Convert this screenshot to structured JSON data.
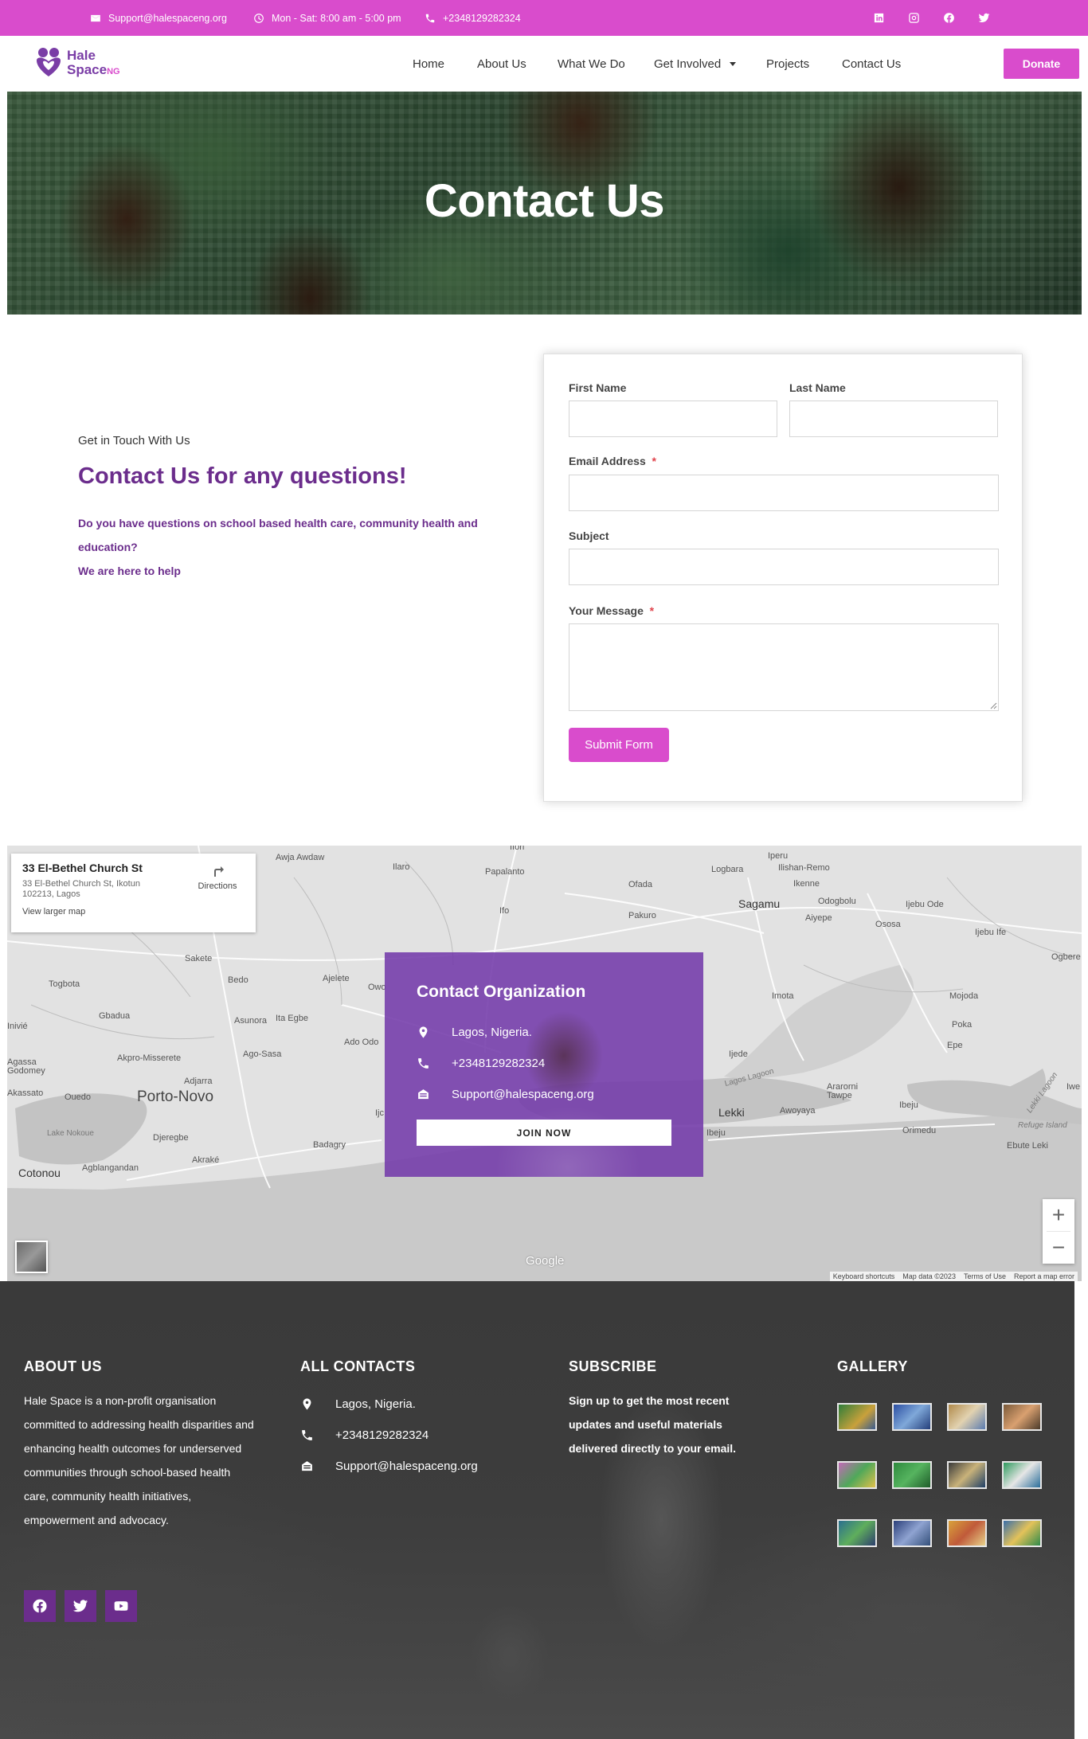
{
  "topbar": {
    "email": "Support@halespaceng.org",
    "hours": "Mon - Sat: 8:00 am - 5:00 pm",
    "phone": "+2348129282324",
    "socials": [
      "linkedin-icon",
      "instagram-icon",
      "facebook-icon",
      "twitter-icon"
    ]
  },
  "nav": {
    "logo_text_1": "Hale",
    "logo_text_2": "Space",
    "logo_text_3": "NG",
    "items": [
      "Home",
      "About Us",
      "What We Do",
      "Get Involved",
      "Projects",
      "Contact Us"
    ],
    "donate": "Donate"
  },
  "hero": {
    "title": "Contact Us"
  },
  "intro": {
    "eyebrow": "Get in Touch With Us",
    "title": "Contact Us for any questions!",
    "text1": "Do you have questions on school based health care, community health and education?",
    "text2": "We are here to help"
  },
  "form": {
    "first_name": "First Name",
    "last_name": "Last Name",
    "email": "Email Address",
    "subject": "Subject",
    "message": "Your Message",
    "required_mark": "*",
    "submit": "Submit Form"
  },
  "map": {
    "place_title": "33 El-Bethel Church St",
    "place_address": "33 El-Bethel Church St, Ikotun 102213, Lagos",
    "directions": "Directions",
    "larger_map": "View larger map",
    "google": "Google",
    "zoom_in": "+",
    "zoom_out": "−",
    "attribution": [
      "Keyboard shortcuts",
      "Map data ©2023",
      "Terms of Use",
      "Report a map error"
    ],
    "labels": [
      "Awja Awdaw",
      "Ilaro",
      "Ifori",
      "Papalanto",
      "Ofada",
      "Logbara",
      "Iperu",
      "Ilishan-Remo",
      "Ikenne",
      "Odogbolu",
      "Ijebu Ode",
      "Sagamu",
      "Aiyepe",
      "Pakuro",
      "Ifo",
      "Ososa",
      "Ijebu Ife",
      "Ogbere",
      "Sakete",
      "Bedo",
      "Ajelete",
      "Togbota",
      "Gbadua",
      "Asunora",
      "Ita Egbe",
      "Ado Odo",
      "Agassa Godomey",
      "Akpro-Misserete",
      "Ago-Sasa",
      "Adjarra",
      "Porto-Novo",
      "Ouedo",
      "Akassato",
      "Lake Nokoue",
      "Djeregbe",
      "Badagry",
      "Cotonou",
      "Agblangandan",
      "Akraké",
      "Imota",
      "Mojoda",
      "Poka",
      "Epe",
      "Ijede",
      "Lagos Lagoon",
      "Ararorni Tawpe",
      "Lekki",
      "Awoyaya",
      "Ibeju",
      "Orimedu",
      "Refuge Island",
      "Ebute Leki",
      "Lekki Lagoon",
      "Iwe",
      "Inivié",
      "Ibeju",
      "Ijc",
      "Owo"
    ]
  },
  "contact_org": {
    "title": "Contact Organization",
    "location": "Lagos, Nigeria.",
    "phone": "+2348129282324",
    "email": "Support@halespaceng.org",
    "join": "JOIN NOW"
  },
  "footer": {
    "about_title": "ABOUT US",
    "about_text": "Hale Space is a non-profit organisation committed to addressing health disparities and enhancing health outcomes for underserved communities through school-based health care, community health initiatives, empowerment and advocacy.",
    "contacts_title": "ALL CONTACTS",
    "location": "Lagos, Nigeria.",
    "phone": "+2348129282324",
    "email": "Support@halespaceng.org",
    "subscribe_title": "SUBSCRIBE",
    "subscribe_text": "Sign up to get the most recent updates and useful materials delivered directly to your email.",
    "gallery_title": "GALLERY",
    "socials": [
      "facebook-icon",
      "twitter-icon",
      "youtube-icon"
    ]
  },
  "colors": {
    "brand_pink": "#d94ccc",
    "brand_purple": "#6b2d8c",
    "overlay_purple": "#733aaa",
    "footer_bg": "#3c3c3c"
  }
}
